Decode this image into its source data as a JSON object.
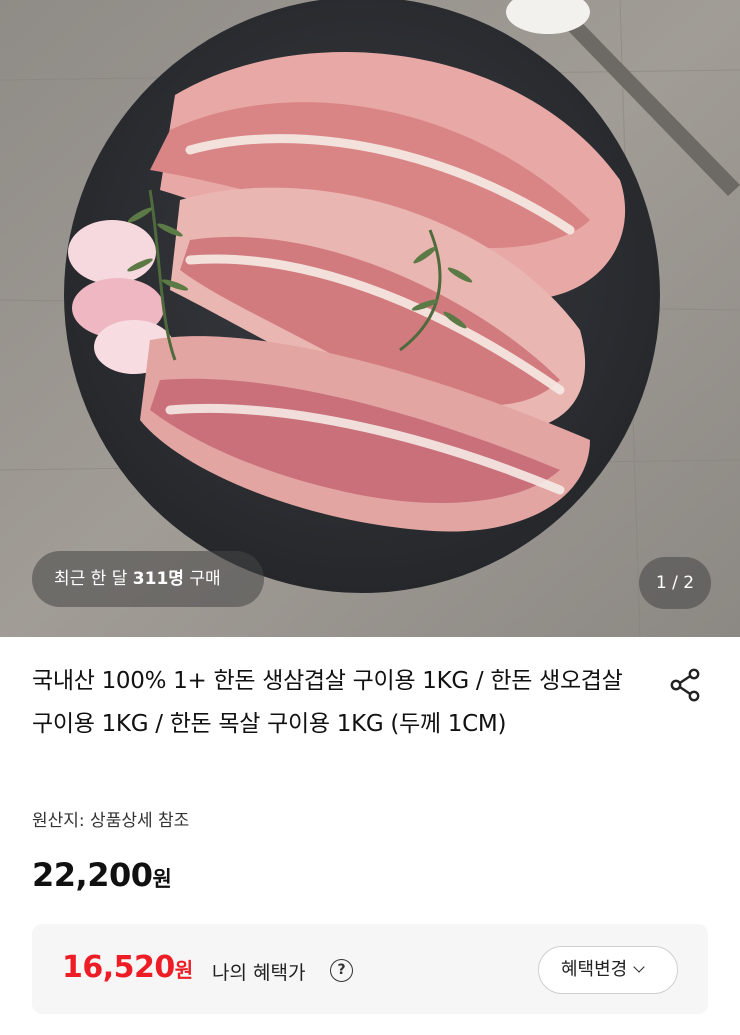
{
  "product": {
    "image_alt": "product photo: pork belly slices on a slate plate",
    "purchase_prefix": "최근 한 달",
    "purchase_count": "311명",
    "purchase_suffix": "구매",
    "page_indicator": "1 / 2",
    "title": "국내산 100% 1+ 한돈 생삼겹살 구이용 1KG / 한돈 생오겹살 구이용 1KG / 한돈 목살 구이용 1KG (두께 1CM)",
    "origin": "원산지: 상품상세 참조",
    "price_amount": "22,200",
    "price_unit": "원"
  },
  "benefit": {
    "price_amount": "16,520",
    "price_unit": "원",
    "label": "나의 혜택가",
    "help_icon": "?",
    "change_label": "혜택변경"
  },
  "icons": {
    "share": "share-icon",
    "help": "question-circle-icon",
    "chevron": "chevron-down-icon"
  },
  "colors": {
    "benefit_price": "#ee1c25",
    "badge_bg": "rgba(70,70,70,0.55)",
    "benefit_bg": "#f6f6f6"
  }
}
